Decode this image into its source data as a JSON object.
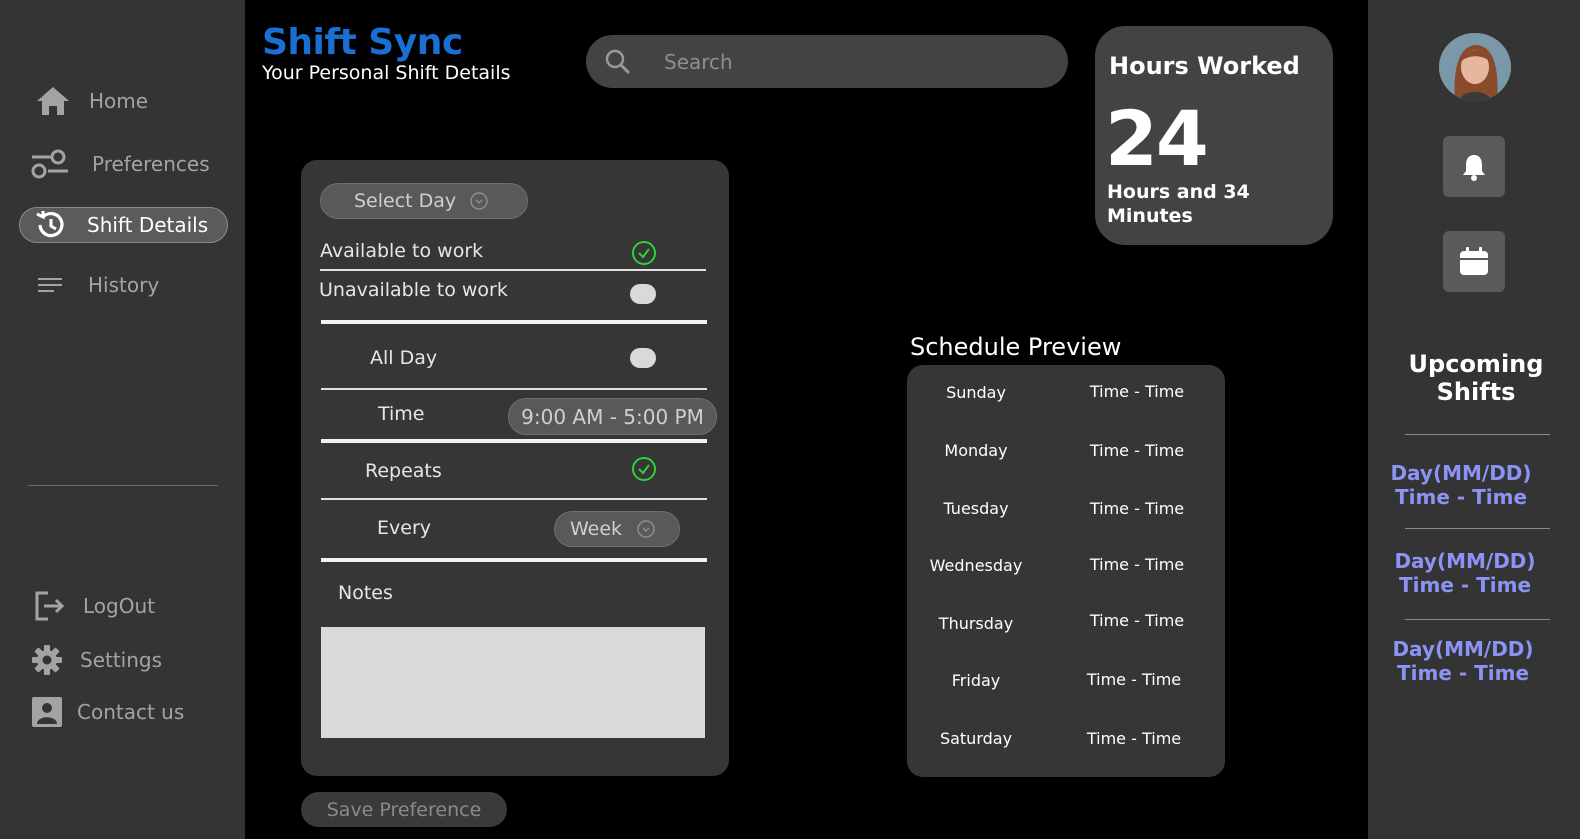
{
  "app": {
    "title": "Shift Sync",
    "subtitle": "Your Personal Shift Details"
  },
  "search": {
    "placeholder": "Search"
  },
  "sidebar": {
    "items": [
      {
        "label": "Home",
        "icon": "home-icon"
      },
      {
        "label": "Preferences",
        "icon": "sliders-icon"
      },
      {
        "label": "Shift Details",
        "icon": "history-clock-icon",
        "active": true
      },
      {
        "label": "History",
        "icon": "list-icon"
      }
    ],
    "bottom_items": [
      {
        "label": "LogOut",
        "icon": "logout-icon"
      },
      {
        "label": "Settings",
        "icon": "gear-icon"
      },
      {
        "label": "Contact us",
        "icon": "contact-icon"
      }
    ]
  },
  "hours": {
    "title": "Hours Worked",
    "value": "24",
    "subtitle": "Hours and 34 Minutes"
  },
  "form": {
    "select_day": "Select Day",
    "available_label": "Available to work",
    "available_checked": true,
    "unavailable_label": "Unavailable to work",
    "unavailable_checked": false,
    "allday_label": "All Day",
    "allday_checked": false,
    "time_label": "Time",
    "time_value": "9:00 AM - 5:00 PM",
    "repeats_label": "Repeats",
    "repeats_checked": true,
    "every_label": "Every",
    "every_value": "Week",
    "notes_label": "Notes",
    "notes_value": "",
    "save_label": "Save Preference"
  },
  "schedule": {
    "title": "Schedule Preview",
    "rows": [
      {
        "day": "Sunday",
        "time": "Time - Time"
      },
      {
        "day": "Monday",
        "time": "Time - Time"
      },
      {
        "day": "Tuesday",
        "time": "Time - Time"
      },
      {
        "day": "Wednesday",
        "time": "Time - Time"
      },
      {
        "day": "Thursday",
        "time": "Time - Time"
      },
      {
        "day": "Friday",
        "time": "Time - Time"
      },
      {
        "day": "Saturday",
        "time": "Time - Time"
      }
    ]
  },
  "upcoming": {
    "title": "Upcoming Shifts",
    "shifts": [
      {
        "date": "Day(MM/DD)",
        "time": "Time - Time"
      },
      {
        "date": "Day(MM/DD)",
        "time": "Time - Time"
      },
      {
        "date": "Day(MM/DD)",
        "time": "Time - Time"
      }
    ]
  },
  "colors": {
    "brand": "#1a6fd3",
    "check_green": "#2fd13a",
    "upcoming_text": "#8b93f4",
    "sidebar_bg": "#343434",
    "panel_bg": "#363636"
  },
  "right_icons": [
    "avatar",
    "bell-icon",
    "calendar-icon"
  ]
}
